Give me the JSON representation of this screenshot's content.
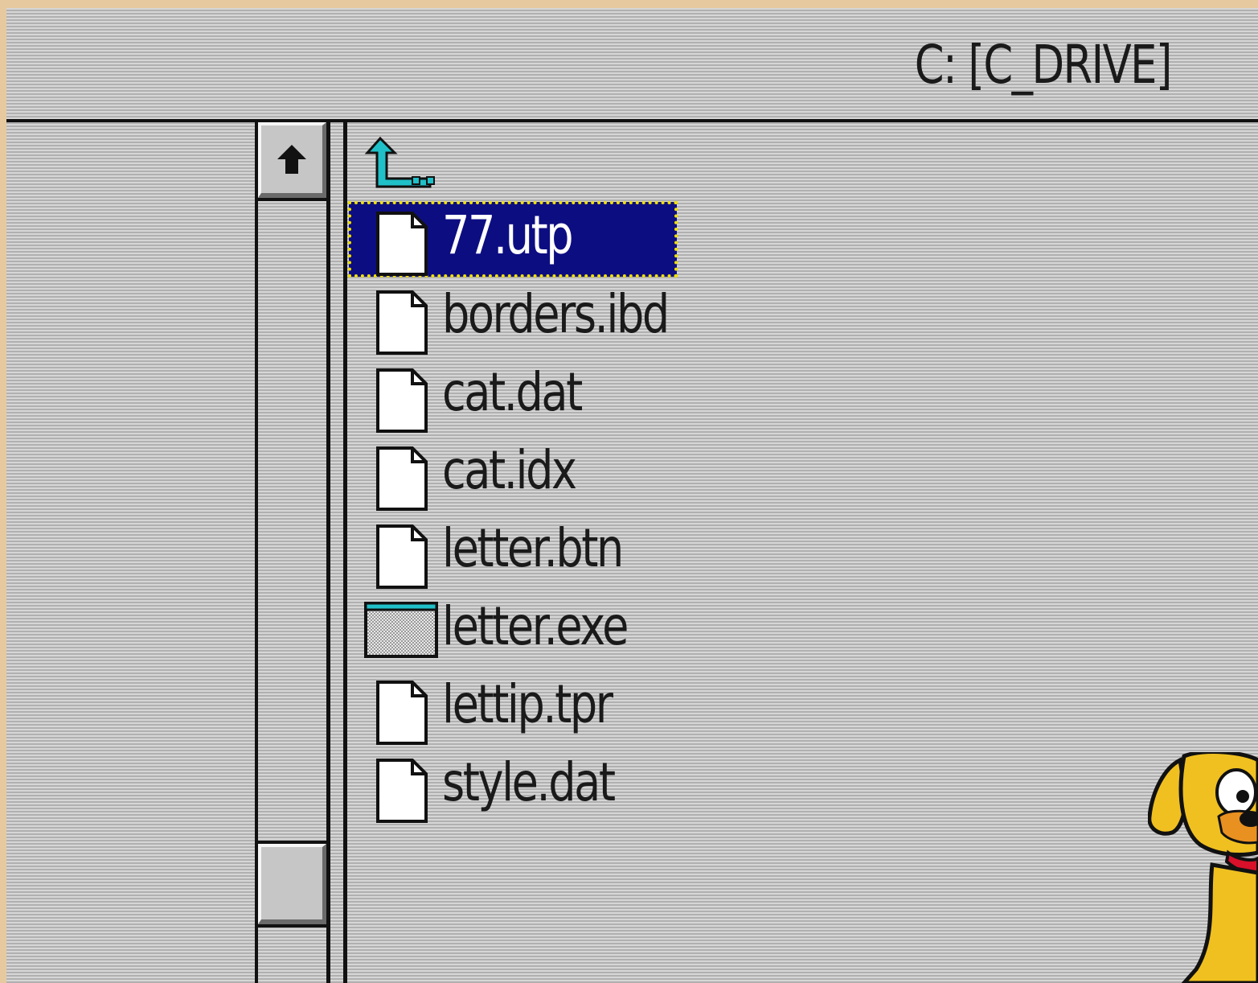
{
  "drive": {
    "label": "C: [C_DRIVE]"
  },
  "scrollbar": {
    "up_arrow_icon": "arrow-up-icon"
  },
  "parent_dir": {
    "icon": "parent-directory-arrow-icon"
  },
  "files": [
    {
      "name": "77.utp",
      "icon": "document-icon",
      "selected": true
    },
    {
      "name": "borders.ibd",
      "icon": "document-icon",
      "selected": false
    },
    {
      "name": "cat.dat",
      "icon": "document-icon",
      "selected": false
    },
    {
      "name": "cat.idx",
      "icon": "document-icon",
      "selected": false
    },
    {
      "name": "letter.btn",
      "icon": "document-icon",
      "selected": false
    },
    {
      "name": "letter.exe",
      "icon": "application-window-icon",
      "selected": false
    },
    {
      "name": "lettip.tpr",
      "icon": "document-icon",
      "selected": false
    },
    {
      "name": "style.dat",
      "icon": "document-icon",
      "selected": false
    }
  ],
  "mascot": {
    "icon": "dog-mascot-icon"
  },
  "colors": {
    "selection_bg": "#0d0d82",
    "selection_outline": "#f0e000",
    "accent_cyan": "#20c0c8",
    "dog_yellow": "#f0c020",
    "background_stripe": "#b0b0b0"
  }
}
